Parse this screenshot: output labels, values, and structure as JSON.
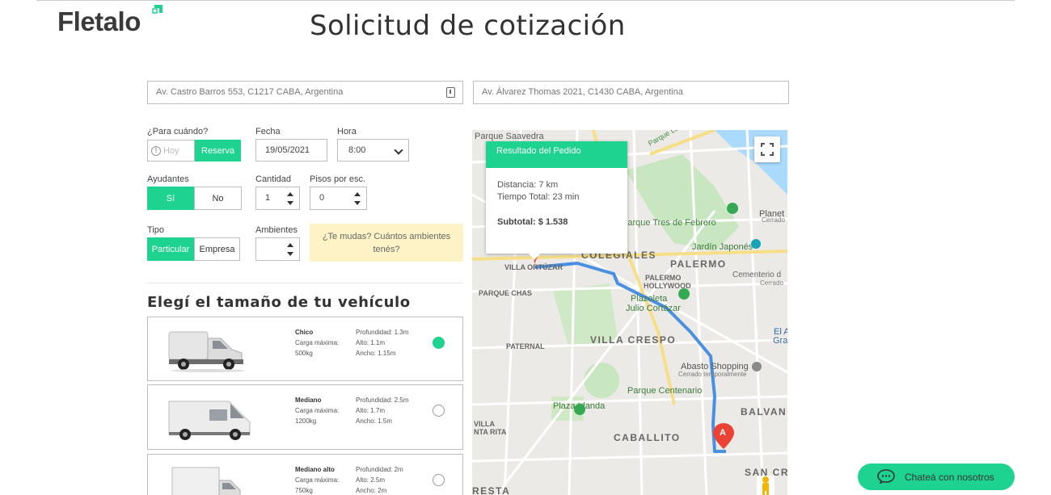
{
  "brand": {
    "name": "Fletalo",
    "accent": "#1ed38f"
  },
  "page_title": "Solicitud de cotización",
  "addresses": {
    "origin": "Av. Castro Barros 553, C1217 CABA, Argentina",
    "destination": "Av. Álvarez Thomas 2021, C1430 CABA, Argentina"
  },
  "when": {
    "label": "¿Para cuándo?",
    "today": "Hoy",
    "reserve": "Reserva",
    "selected": "Reserva"
  },
  "date": {
    "label": "Fecha",
    "value": "19/05/2021"
  },
  "time": {
    "label": "Hora",
    "value": "8:00"
  },
  "helpers": {
    "label": "Ayudantes",
    "yes": "Sí",
    "no": "No",
    "selected": "Sí"
  },
  "quantity": {
    "label": "Cantidad",
    "value": "1"
  },
  "floors": {
    "label": "Pisos por esc.",
    "value": "0"
  },
  "type": {
    "label": "Tipo",
    "particular": "Particular",
    "company": "Empresa",
    "selected": "Particular"
  },
  "rooms": {
    "label": "Ambientes",
    "value": ""
  },
  "hint": {
    "line1": "¿Te mudas? Cuántos ambientes",
    "line2": "tenés?"
  },
  "vehicle_section_title": "Elegí el tamaño de tu vehículo",
  "vehicles": [
    {
      "name": "Chico",
      "load_label": "Carga máxima:",
      "load": "500kg",
      "depth": "Profundidad: 1.3m",
      "height": "Alto: 1.1m",
      "width": "Ancho: 1.15m",
      "selected": true
    },
    {
      "name": "Mediano",
      "load_label": "Carga máxima:",
      "load": "1200kg",
      "depth": "Profundidad: 2.5m",
      "height": "Alto: 1.7m",
      "width": "Ancho: 1.5m",
      "selected": false
    },
    {
      "name": "Mediano alto",
      "load_label": "Carga máxima:",
      "load": "750kg",
      "depth": "Profundidad: 2m",
      "height": "Alto: 2.5m",
      "width": "Ancho: 2m",
      "selected": false
    }
  ],
  "result": {
    "title": "Resultado del Pedido",
    "distance": "Distancia: 7 km",
    "time": "Tiempo Total: 23 min",
    "subtotal": "Subtotal: $ 1.538"
  },
  "map_labels": {
    "saavedra": "Parque Saavedra",
    "lugones": "Parque Lugones",
    "colegiales": "COLEGIALES",
    "palermo": "PALERMO",
    "tres_febrero": "Parque Tres de Febrero",
    "jardin": "Jardín Japonés",
    "planetario": "Planet",
    "cerrado": "Cerrado",
    "villa_ortuzar": "VILLA ORTÚZAR",
    "cementerio": "Cementerio d",
    "cementerio2": "Cerrado",
    "palermo_h1": "PALERMO",
    "palermo_h2": "HOLLYWOOD",
    "parque_chas": "PARQUE CHAS",
    "plazoleta1": "Plazoleta",
    "plazoleta2": "Julio Cortázar",
    "grand_sp": "Grand Sp",
    "el_a": "El A",
    "paternal": "PATERNAL",
    "villa_crespo": "VILLA CRESPO",
    "abasto1": "Abasto Shopping",
    "abasto2": "Cerrado temporalmente",
    "centenario": "Parque Centenario",
    "plaza_irlanda": "Plaza Irlanda",
    "balvan": "BALVAN",
    "villa_rita1": "VILLA",
    "villa_rita2": "NTA RITA",
    "caballito": "CABALLITO",
    "san_cr": "SAN CR",
    "resta": "RESTA",
    "pin_a": "A"
  },
  "chat": {
    "label": "Chateá con nosotros"
  }
}
